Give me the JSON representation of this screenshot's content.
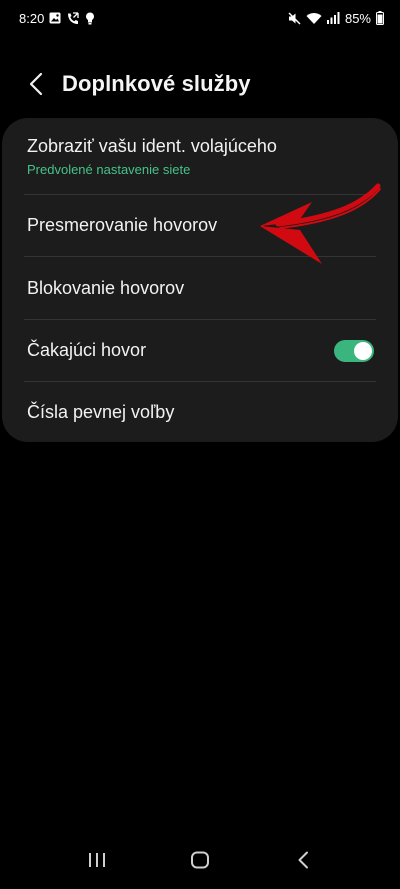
{
  "status_bar": {
    "time": "8:20",
    "battery": "85%"
  },
  "header": {
    "title": "Doplnkové služby"
  },
  "settings": {
    "items": [
      {
        "label": "Zobraziť vašu ident. volajúceho",
        "sublabel": "Predvolené nastavenie siete"
      },
      {
        "label": "Presmerovanie hovorov"
      },
      {
        "label": "Blokovanie hovorov"
      },
      {
        "label": "Čakajúci hovor",
        "toggle_on": true
      },
      {
        "label": "Čísla pevnej voľby"
      }
    ]
  },
  "colors": {
    "background": "#000000",
    "card": "#1c1c1c",
    "accent_green": "#3bb57e",
    "annotation_red": "#d10a12"
  },
  "icons": {
    "status_left": [
      "image-icon",
      "call-forward-icon",
      "bulb-icon"
    ],
    "status_right": [
      "mute-icon",
      "wifi-icon",
      "signal-icon",
      "battery-icon"
    ],
    "nav": [
      "recent-apps-icon",
      "home-icon",
      "back-nav-icon"
    ]
  }
}
